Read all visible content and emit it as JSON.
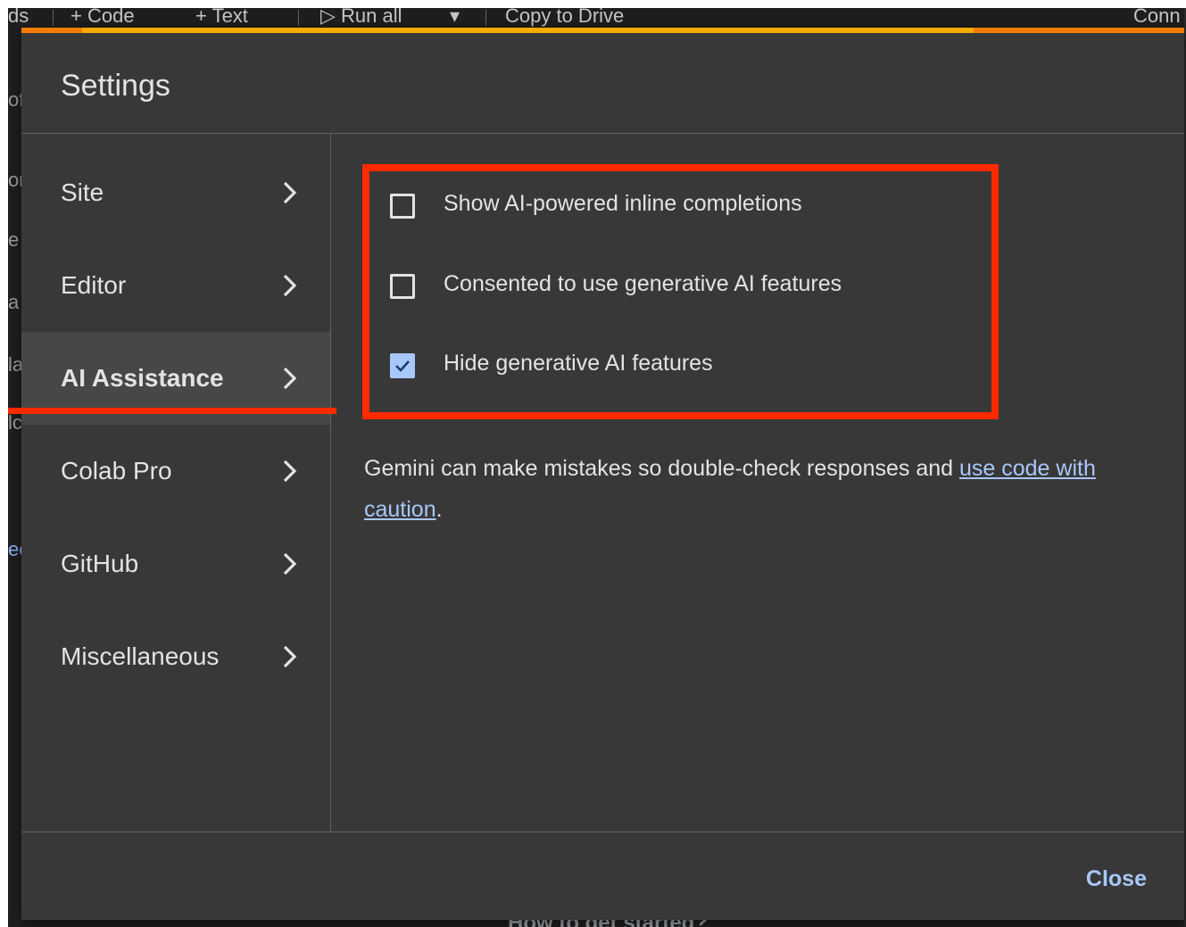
{
  "toolbar": {
    "left_fragment": "ds",
    "code_label": "+ Code",
    "text_label": "+ Text",
    "run_all_label": "▷ Run all",
    "run_all_menu": "▾",
    "copy_to_drive_label": "Copy to Drive",
    "connect_fragment": "Conn"
  },
  "background_fragments": [
    "of",
    "or",
    "e",
    "a",
    "la",
    "lc",
    "ec"
  ],
  "background_bottom_text": "How to get started?",
  "dialog": {
    "title": "Settings",
    "nav": [
      {
        "label": "Site"
      },
      {
        "label": "Editor"
      },
      {
        "label": "AI Assistance"
      },
      {
        "label": "Colab Pro"
      },
      {
        "label": "GitHub"
      },
      {
        "label": "Miscellaneous"
      }
    ],
    "active_nav": "AI Assistance",
    "options": [
      {
        "label": "Show AI-powered inline completions",
        "checked": false
      },
      {
        "label": "Consented to use generative AI features",
        "checked": false
      },
      {
        "label": "Hide generative AI features",
        "checked": true
      }
    ],
    "note_text": "Gemini can make mistakes so double-check responses and ",
    "note_link": "use code with caution",
    "note_end": ".",
    "close_label": "Close"
  },
  "colors": {
    "accent": "#a8c7fa",
    "annotation": "#ff2a00",
    "progress": "#f9ab00",
    "dialog_bg": "#383838"
  }
}
